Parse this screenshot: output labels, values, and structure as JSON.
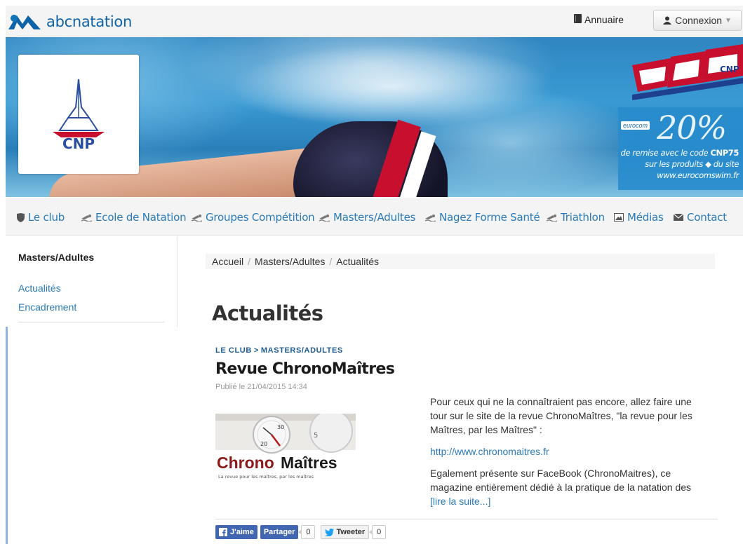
{
  "header": {
    "logo_text": "abcnatation",
    "annuaire_label": "Annuaire",
    "connexion_label": "Connexion"
  },
  "banner": {
    "club_logo_text": "CNP",
    "sponsor_logo_text": "CNP",
    "promo": {
      "brand": "eurocom",
      "percent": "20%",
      "line1_prefix": "de remise avec le code",
      "line1_code": "CNP75",
      "line2": "sur les produits",
      "line2_suffix": "du site",
      "line3": "www.eurocomswim.fr"
    }
  },
  "nav": {
    "items": [
      {
        "label": "Le club",
        "icon": "shield-icon"
      },
      {
        "label": "Ecole de Natation",
        "icon": "swimmer-icon"
      },
      {
        "label": "Groupes Compétition",
        "icon": "swimmer-icon"
      },
      {
        "label": "Masters/Adultes",
        "icon": "swimmer-icon"
      },
      {
        "label": "Nagez Forme Santé",
        "icon": "swimmer-icon"
      },
      {
        "label": "Triathlon",
        "icon": "swimmer-icon"
      },
      {
        "label": "Médias",
        "icon": "image-icon"
      },
      {
        "label": "Contact",
        "icon": "envelope-icon"
      }
    ]
  },
  "sidebar": {
    "title": "Masters/Adultes",
    "links": [
      "Actualités",
      "Encadrement"
    ]
  },
  "breadcrumb": [
    "Accueil",
    "Masters/Adultes",
    "Actualités"
  ],
  "page_title": "Actualités",
  "article": {
    "category_1": "LE CLUB",
    "category_sep": ">",
    "category_2": "MASTERS/ADULTES",
    "title": "Revue ChronoMaîtres",
    "date": "Publié le 21/04/2015 14:34",
    "image_brand_1": "Chrono",
    "image_brand_2": "Maîtres",
    "image_tagline": "La revue pour les maîtres, par les maîtres",
    "paragraph_1": "Pour ceux qui ne la connaîtraient pas encore, allez faire une tour sur le site de la revue ChronoMaîtres, \"la revue pour les Maîtres, par les Maîtres\" :",
    "link": "http://www.chronomaitres.fr",
    "paragraph_2": "Egalement présente sur FaceBook (ChronoMaitres), ce magazine entièrement dédié à la pratique de la natation des",
    "read_more": "[lire la suite...]"
  },
  "share": {
    "like_label": "J'aime",
    "share_label": "Partager",
    "share_count": "0",
    "tweet_label": "Tweeter",
    "tweet_count": "0"
  },
  "colors": {
    "link": "#2a7ab8",
    "brand_blue": "#0e63a8",
    "facebook": "#4267b2",
    "cnp_red": "#c8102e"
  }
}
